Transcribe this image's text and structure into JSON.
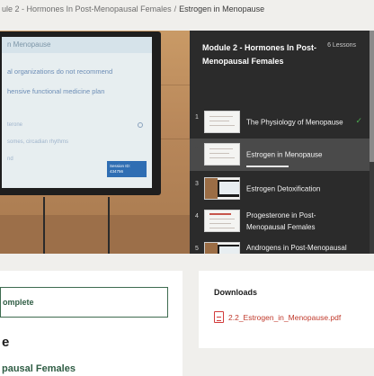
{
  "breadcrumb": {
    "parent": "ule 2 - Hormones In Post-Menopausal Females",
    "separator": "/",
    "current": "Estrogen in Menopause"
  },
  "video": {
    "slide_title": "n Menopause",
    "slide_lines": [
      "al organizations do not recommend",
      "hensive functional medicine plan",
      "terone",
      "somes, circadian rhythms",
      "nd"
    ],
    "badge_text": "Session ID: 434756"
  },
  "sidebar": {
    "module_title": "Module 2 - Hormones In Post-Menopausal Females",
    "lesson_count": "6 Lessons",
    "accent_check_color": "#4caf50",
    "lessons": [
      {
        "num": "1",
        "label": "The Physiology of Menopause",
        "completed": true,
        "active": false,
        "thumb": "slide"
      },
      {
        "num": "2",
        "label": "Estrogen in Menopause",
        "completed": false,
        "active": true,
        "thumb": "slide"
      },
      {
        "num": "3",
        "label": "Estrogen Detoxification",
        "completed": false,
        "active": false,
        "thumb": "video"
      },
      {
        "num": "4",
        "label": "Progesterone in Post-Menopausal Females",
        "completed": false,
        "active": false,
        "thumb": "slide-red"
      },
      {
        "num": "5",
        "label": "Androgens in Post-Menopausal Females",
        "completed": false,
        "active": false,
        "thumb": "video"
      }
    ]
  },
  "lesson_panel": {
    "complete_button": "omplete",
    "title": "e",
    "subtitle": "pausal Females"
  },
  "downloads": {
    "title": "Downloads",
    "file": "2.2_Estrogen_in_Menopause.pdf"
  }
}
